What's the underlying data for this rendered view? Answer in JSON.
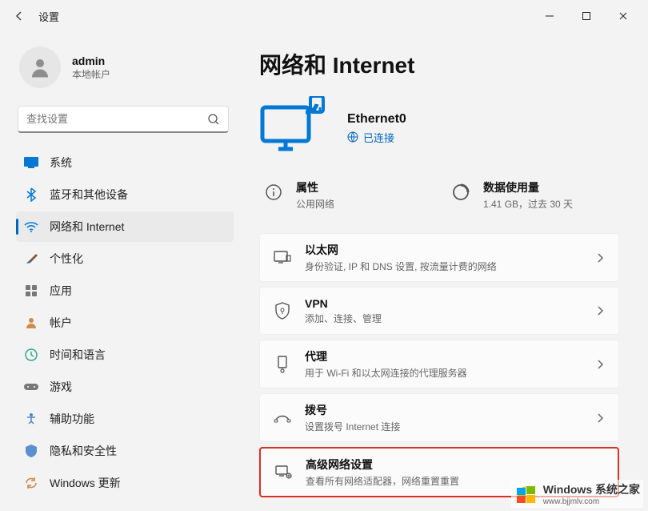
{
  "window": {
    "title": "设置"
  },
  "user": {
    "name": "admin",
    "type": "本地帐户"
  },
  "search": {
    "placeholder": "查找设置"
  },
  "nav": {
    "items": [
      {
        "label": "系统"
      },
      {
        "label": "蓝牙和其他设备"
      },
      {
        "label": "网络和 Internet"
      },
      {
        "label": "个性化"
      },
      {
        "label": "应用"
      },
      {
        "label": "帐户"
      },
      {
        "label": "时间和语言"
      },
      {
        "label": "游戏"
      },
      {
        "label": "辅助功能"
      },
      {
        "label": "隐私和安全性"
      },
      {
        "label": "Windows 更新"
      }
    ]
  },
  "page": {
    "title": "网络和 Internet",
    "connection": {
      "name": "Ethernet0",
      "status": "已连接"
    },
    "stats": {
      "properties": {
        "title": "属性",
        "sub": "公用网络"
      },
      "usage": {
        "title": "数据使用量",
        "sub": "1.41 GB，过去 30 天"
      }
    },
    "cards": [
      {
        "title": "以太网",
        "sub": "身份验证, IP 和 DNS 设置, 按流量计费的网络"
      },
      {
        "title": "VPN",
        "sub": "添加、连接、管理"
      },
      {
        "title": "代理",
        "sub": "用于 Wi-Fi 和以太网连接的代理服务器"
      },
      {
        "title": "拨号",
        "sub": "设置拨号 Internet 连接"
      },
      {
        "title": "高级网络设置",
        "sub": "查看所有网络适配器，网络重置重置"
      }
    ]
  },
  "watermark": {
    "text": "Windows 系统之家",
    "url": "www.bjjmlv.com"
  }
}
